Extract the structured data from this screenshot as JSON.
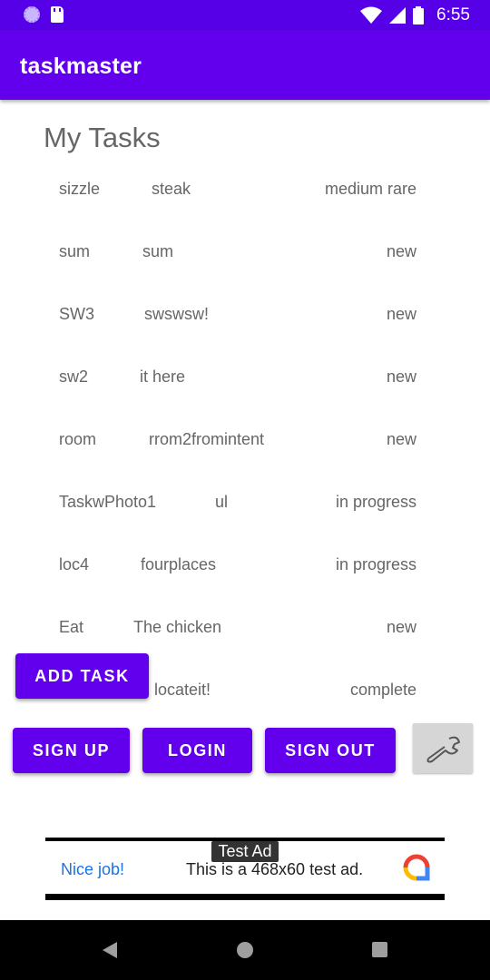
{
  "status_bar": {
    "time": "6:55"
  },
  "app_bar": {
    "title": "taskmaster"
  },
  "heading": "My Tasks",
  "tasks": [
    {
      "title": "sizzle",
      "body": "steak",
      "state": "medium rare"
    },
    {
      "title": "sum",
      "body": "sum",
      "state": "new"
    },
    {
      "title": "SW3",
      "body": "swswsw!",
      "state": "new"
    },
    {
      "title": "sw2",
      "body": "it here",
      "state": "new"
    },
    {
      "title": "room",
      "body": "rrom2fromintent",
      "state": "new"
    },
    {
      "title": "TaskwPhoto1",
      "body": "ul",
      "state": "in progress"
    },
    {
      "title": "loc4",
      "body": "fourplaces",
      "state": "in progress"
    },
    {
      "title": "Eat",
      "body": "The chicken",
      "state": "new"
    },
    {
      "title": "",
      "body": "locateit!",
      "state": "complete"
    }
  ],
  "buttons": {
    "add_task": "ADD TASK",
    "sign_up": "SIGN UP",
    "login": "LOGIN",
    "sign_out": "SIGN OUT",
    "settings_icon": "wrench-icon"
  },
  "ad": {
    "label": "Test Ad",
    "nice_job": "Nice job!",
    "text": "This is a 468x60 test ad."
  },
  "colors": {
    "primary": "#6200ee",
    "status_bar": "#5600e8"
  }
}
